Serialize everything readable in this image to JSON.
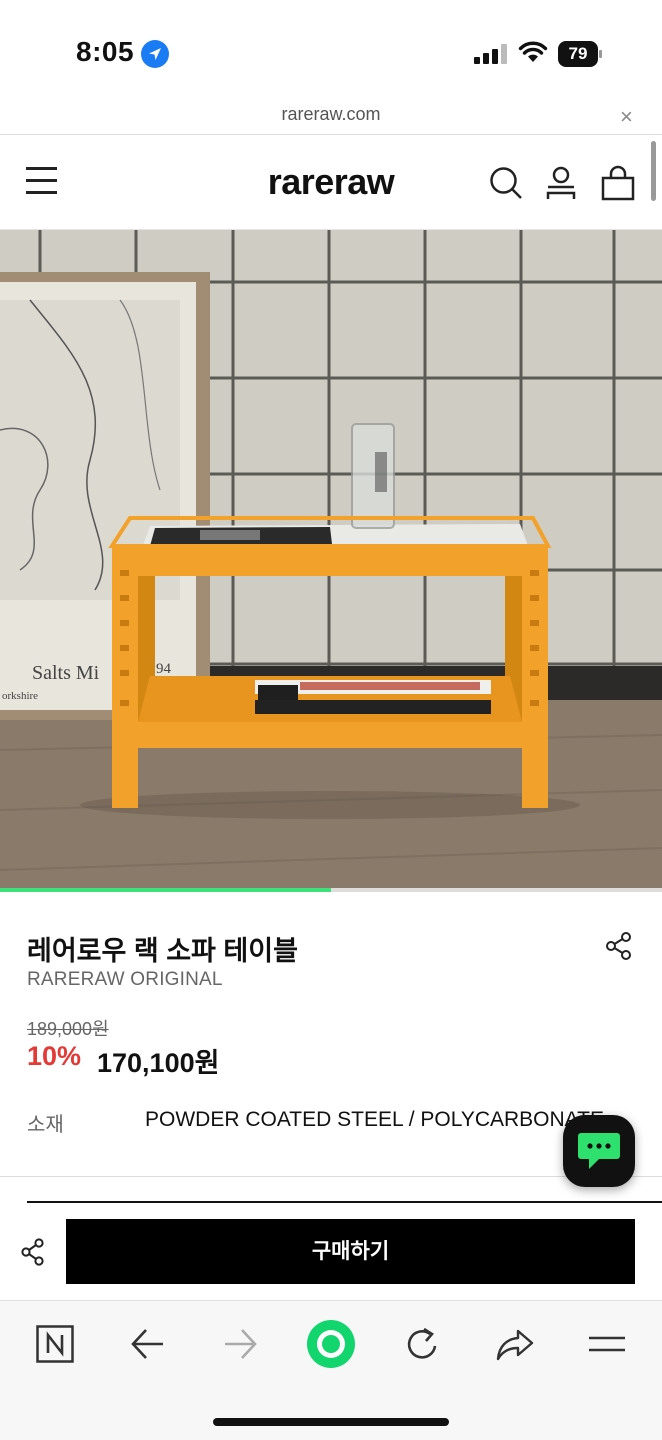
{
  "status_bar": {
    "time": "8:05",
    "battery": "79"
  },
  "browser": {
    "url": "rareraw.com",
    "close": "×"
  },
  "header": {
    "logo": "rareraw"
  },
  "hero": {
    "poster_caption": "Salts Mi",
    "poster_year": "94",
    "poster_sub": "orkshire",
    "carousel_progress": 0.5
  },
  "product": {
    "title": "레어로우 랙 소파 테이블",
    "brand": "RARERAW ORIGINAL",
    "original_price": "189,000원",
    "discount": "10%",
    "sale_price": "170,100원",
    "spec_label": "소재",
    "spec_value": "POWDER COATED STEEL / POLYCARBONATE"
  },
  "buy_bar": {
    "button_label": "구매하기"
  },
  "colors": {
    "accent_green": "#3ee07a",
    "discount_red": "#e53935",
    "furniture_orange": "#f2a22a"
  }
}
